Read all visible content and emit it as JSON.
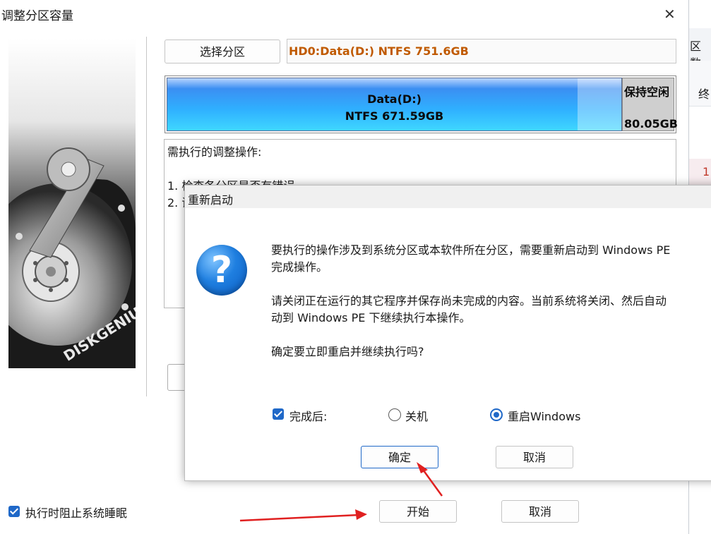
{
  "background": {
    "right_panel": {
      "header_text": "区数",
      "col_label": "终",
      "row_value": "1"
    }
  },
  "main_window": {
    "title": "调整分区容量",
    "close_icon": "✕",
    "select_button": "选择分区",
    "partition_info": "HD0:Data(D:) NTFS 751.6GB",
    "disk_bar": {
      "data_label": "Data(D:)",
      "data_size": "NTFS 671.59GB",
      "reserve_label": "保持空闲",
      "reserve_size": "80.05GB"
    },
    "ops": {
      "heading": "需执行的调整操作:",
      "line1": "1. 检查各分区是否有错误",
      "line2": "2. 调"
    },
    "prevent_sleep_label": "执行时阻止系统睡眠",
    "start_button": "开始",
    "cancel_button": "取消"
  },
  "dialog": {
    "title": "重新启动",
    "icon": "question-icon",
    "icon_glyph": "?",
    "message_line1": "要执行的操作涉及到系统分区或本软件所在分区，需要重新启动到 Windows PE",
    "message_line2": "完成操作。",
    "message_line3": "请关闭正在运行的其它程序并保存尚未完成的内容。当前系统将关闭、然后自动",
    "message_line4": "动到 Windows PE 下继续执行本操作。",
    "message_line5": "确定要立即重启并继续执行吗?",
    "after_label": "完成后:",
    "option_shutdown": "关机",
    "option_restart": "重启Windows",
    "selected_option": "重启Windows",
    "ok_button": "确定",
    "cancel_button": "取消"
  },
  "colors": {
    "accent": "#1f68c8",
    "partition_info_text": "#c05a00",
    "annotation_arrow": "#e02020"
  }
}
